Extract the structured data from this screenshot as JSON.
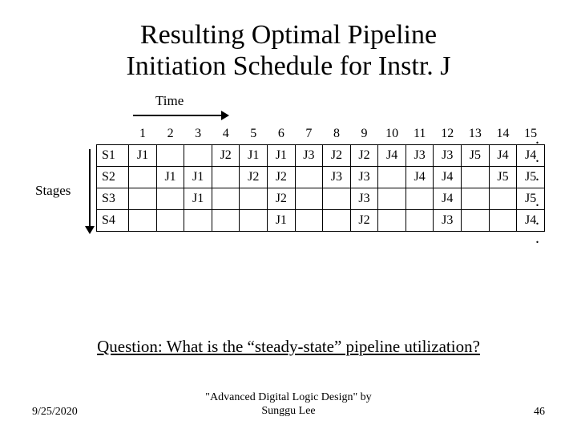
{
  "title_line1": "Resulting Optimal Pipeline",
  "title_line2": "Initiation Schedule for Instr. J",
  "time_label": "Time",
  "stages_label": "Stages",
  "ellipsis": ". . .",
  "question": "Question: What is the “steady-state” pipeline utilization?",
  "footer": {
    "date": "9/25/2020",
    "center_line1": "\"Advanced Digital Logic Design\" by",
    "center_line2": "Sunggu Lee",
    "page": "46"
  },
  "chart_data": {
    "type": "table",
    "title": "Pipeline initiation schedule",
    "xlabel": "Time",
    "ylabel": "Stages",
    "time_steps": [
      "1",
      "2",
      "3",
      "4",
      "5",
      "6",
      "7",
      "8",
      "9",
      "10",
      "11",
      "12",
      "13",
      "14",
      "15"
    ],
    "stages": [
      "S1",
      "S2",
      "S3",
      "S4"
    ],
    "cells": {
      "S1": [
        "J1",
        "",
        "",
        "J2",
        "J1",
        "J1",
        "J3",
        "J2",
        "J2",
        "J4",
        "J3",
        "J3",
        "J5",
        "J4",
        "J4"
      ],
      "S2": [
        "",
        "J1",
        "J1",
        "",
        "J2",
        "J2",
        "",
        "J3",
        "J3",
        "",
        "J4",
        "J4",
        "",
        "J5",
        "J5"
      ],
      "S3": [
        "",
        "",
        "J1",
        "",
        "",
        "J2",
        "",
        "",
        "J3",
        "",
        "",
        "J4",
        "",
        "",
        "J5"
      ],
      "S4": [
        "",
        "",
        "",
        "",
        "",
        "J1",
        "",
        "",
        "J2",
        "",
        "",
        "J3",
        "",
        "",
        "J4"
      ]
    }
  }
}
